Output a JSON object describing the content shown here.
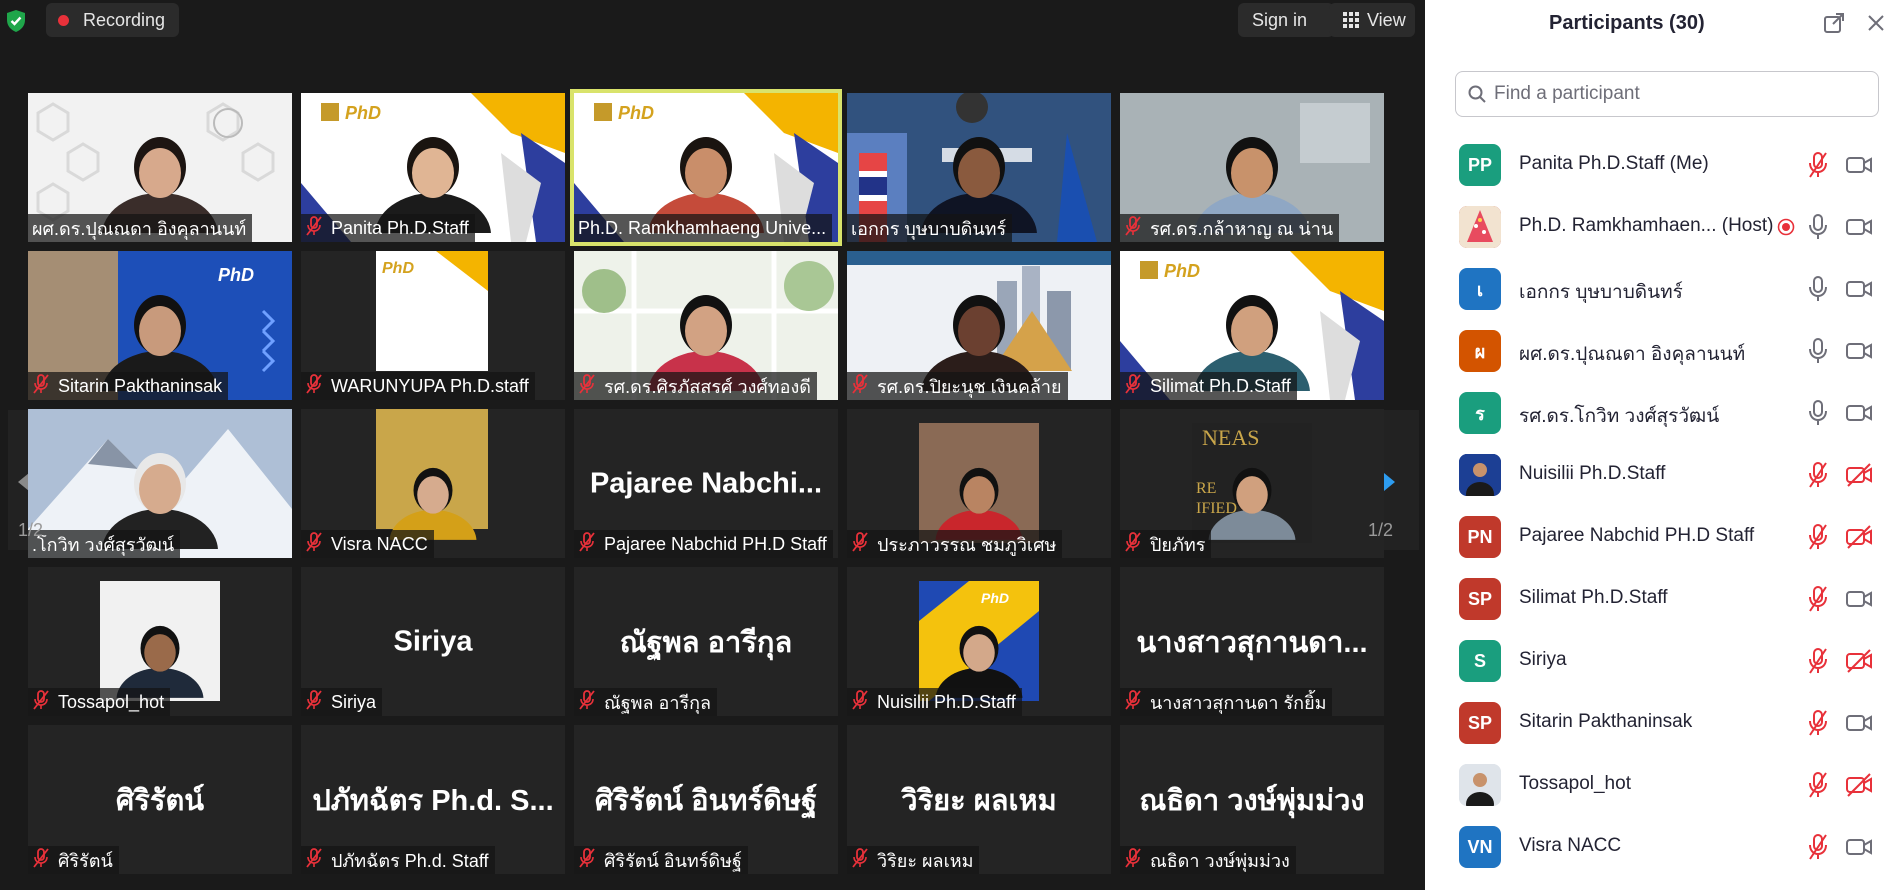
{
  "meeting": {
    "recording_label": "Recording",
    "sign_in_label": "Sign in",
    "view_label": "View",
    "page_indicator_left": "1/2",
    "page_indicator_right": "1/2",
    "active_color": "#d9e36b"
  },
  "tiles": [
    {
      "name": "ผศ.ดร.ปุณณดา อิงคุลานนท์",
      "muted": false,
      "kind": "photo"
    },
    {
      "name": "Panita Ph.D.Staff",
      "muted": true,
      "kind": "photo"
    },
    {
      "name": "Ph.D. Ramkhamhaeng Unive...",
      "muted": false,
      "kind": "photo",
      "active": true
    },
    {
      "name": "เอกกร บุษบาบดินทร์",
      "muted": false,
      "kind": "photo"
    },
    {
      "name": "รศ.ดร.กล้าหาญ ณ น่าน",
      "muted": true,
      "kind": "photo"
    },
    {
      "name": "Sitarin Pakthaninsak",
      "muted": true,
      "kind": "photo"
    },
    {
      "name": "WARUNYUPA Ph.D.staff",
      "muted": true,
      "kind": "photo"
    },
    {
      "name": "รศ.ดร.ศิรภัสสรศ์ วงศ์ทองดี",
      "muted": true,
      "kind": "photo"
    },
    {
      "name": "รศ.ดร.ปิยะนุช เงินคล้าย",
      "muted": true,
      "kind": "photo"
    },
    {
      "name": "Silimat Ph.D.Staff",
      "muted": true,
      "kind": "photo"
    },
    {
      "name": ".โกวิท วงศ์สุรวัฒน์",
      "muted": false,
      "kind": "photo"
    },
    {
      "name": "Visra NACC",
      "muted": true,
      "kind": "photo"
    },
    {
      "name": "Pajaree Nabchid PH.D Staff",
      "muted": true,
      "kind": "text",
      "display": "Pajaree  Nabchi..."
    },
    {
      "name": "ประภาวรรณ ชมภูวิเศษ",
      "muted": true,
      "kind": "photo"
    },
    {
      "name": "ปิยภัทร",
      "muted": true,
      "kind": "photo"
    },
    {
      "name": "Tossapol_hot",
      "muted": true,
      "kind": "photo"
    },
    {
      "name": "Siriya",
      "muted": true,
      "kind": "text",
      "display": "Siriya"
    },
    {
      "name": "ณัฐพล อารีกุล",
      "muted": true,
      "kind": "text",
      "display": "ณัฐพล อารีกุล"
    },
    {
      "name": "Nuisilii Ph.D.Staff",
      "muted": true,
      "kind": "photo"
    },
    {
      "name": "นางสาวสุกานดา  รักยิ้ม",
      "muted": true,
      "kind": "text",
      "display": "นางสาวสุกานดา..."
    },
    {
      "name": "ศิริรัตน์",
      "muted": true,
      "kind": "text",
      "display": "ศิริรัตน์"
    },
    {
      "name": "ปภัทฉัตร Ph.d. Staff",
      "muted": true,
      "kind": "text",
      "display": "ปภัทฉัตร Ph.d. S..."
    },
    {
      "name": "ศิริรัตน์ อินทร์ดิษฐ์",
      "muted": true,
      "kind": "text",
      "display": "ศิริรัตน์ อินทร์ดิษฐ์"
    },
    {
      "name": "วิริยะ ผลเหม",
      "muted": true,
      "kind": "text",
      "display": "วิริยะ ผลเหม"
    },
    {
      "name": "ณธิดา วงษ์พุ่มม่วง",
      "muted": true,
      "kind": "text",
      "display": "ณธิดา วงษ์พุ่มม่วง"
    }
  ],
  "participants_panel": {
    "title": "Participants (30)",
    "search_placeholder": "Find a participant",
    "items": [
      {
        "initials": "PP",
        "color": "#1a9e7e",
        "name": "Panita Ph.D.Staff (Me)",
        "mic": "muted",
        "cam": "on"
      },
      {
        "initials": "",
        "color": "#c0392b",
        "name": "Ph.D. Ramkhamhaen... (Host)",
        "mic": "on",
        "cam": "on",
        "recording": true,
        "icon": "christmas-tree-avatar"
      },
      {
        "initials": "เ",
        "color": "#1f74c2",
        "name": "เอกกร บุษบาบดินทร์",
        "mic": "on",
        "cam": "on"
      },
      {
        "initials": "ผ",
        "color": "#d35400",
        "name": "ผศ.ดร.ปุณณดา อิงคุลานนท์",
        "mic": "on",
        "cam": "on"
      },
      {
        "initials": "ร",
        "color": "#1a9e7e",
        "name": "รศ.ดร.โกวิท วงศ์สุรวัฒน์",
        "mic": "on",
        "cam": "on"
      },
      {
        "initials": "",
        "color": "#1c3f94",
        "name": "Nuisilii Ph.D.Staff",
        "mic": "muted",
        "cam": "off",
        "icon": "photo-avatar"
      },
      {
        "initials": "PN",
        "color": "#c0392b",
        "name": "Pajaree Nabchid PH.D Staff",
        "mic": "muted",
        "cam": "off"
      },
      {
        "initials": "SP",
        "color": "#c0392b",
        "name": "Silimat Ph.D.Staff",
        "mic": "muted",
        "cam": "on"
      },
      {
        "initials": "S",
        "color": "#1a9e7e",
        "name": "Siriya",
        "mic": "muted",
        "cam": "off"
      },
      {
        "initials": "SP",
        "color": "#c0392b",
        "name": "Sitarin Pakthaninsak",
        "mic": "muted",
        "cam": "on"
      },
      {
        "initials": "",
        "color": "#dfe4ea",
        "name": "Tossapol_hot",
        "mic": "muted",
        "cam": "off",
        "icon": "photo-avatar"
      },
      {
        "initials": "VN",
        "color": "#1f74c2",
        "name": "Visra NACC",
        "mic": "muted",
        "cam": "on"
      }
    ]
  }
}
